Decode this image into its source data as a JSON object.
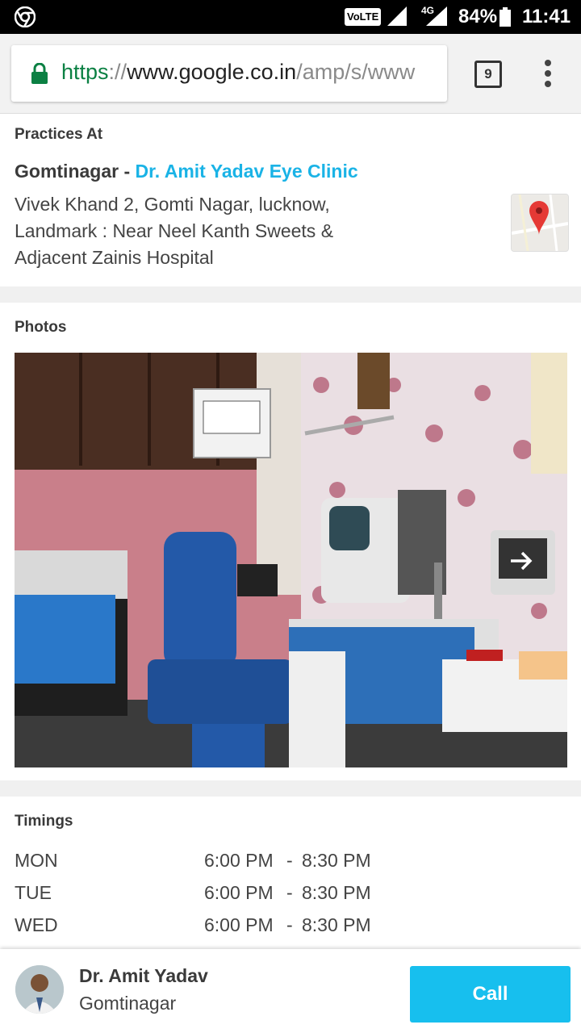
{
  "status_bar": {
    "volte": "VoLTE",
    "network": "4G",
    "battery": "84%",
    "time": "11:41"
  },
  "browser": {
    "url_scheme": "https",
    "url_sep": "://",
    "url_host": "www.google.co.in",
    "url_path": "/amp/s/www",
    "tab_count": "9"
  },
  "practice": {
    "heading": "Practices At",
    "locality": "Gomtinagar - ",
    "clinic": "Dr. Amit Yadav Eye Clinic",
    "address": "Vivek Khand 2, Gomti Nagar, lucknow, Landmark : Near Neel Kanth Sweets & Adjacent Zainis Hospital"
  },
  "photos": {
    "heading": "Photos"
  },
  "timings": {
    "heading": "Timings",
    "rows": [
      {
        "day": "MON",
        "open": "6:00 PM",
        "dash": "-",
        "close": "8:30 PM"
      },
      {
        "day": "TUE",
        "open": "6:00 PM",
        "dash": "-",
        "close": "8:30 PM"
      },
      {
        "day": "WED",
        "open": "6:00 PM",
        "dash": "-",
        "close": "8:30 PM"
      }
    ]
  },
  "footer": {
    "doctor_name": "Dr. Amit Yadav",
    "doctor_location": "Gomtinagar",
    "call_label": "Call"
  }
}
